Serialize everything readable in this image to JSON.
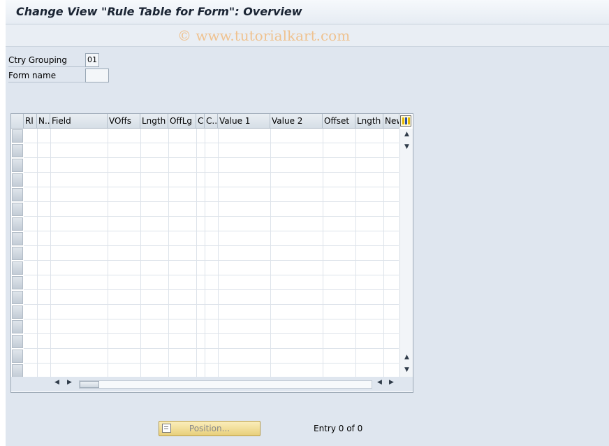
{
  "title": "Change View \"Rule Table for Form\": Overview",
  "watermark": "© www.tutorialkart.com",
  "fields": {
    "ctry_grouping_label": "Ctry Grouping",
    "ctry_grouping_value": "01",
    "form_name_label": "Form name",
    "form_name_value": ""
  },
  "table": {
    "columns": [
      "Rl",
      "N..",
      "Field",
      "VOffs",
      "Lngth",
      "OffLg",
      "C",
      "C..",
      "Value 1",
      "Value 2",
      "Offset",
      "Lngth",
      "New"
    ],
    "visible_rows": 17
  },
  "footer": {
    "position_button": "Position...",
    "entry_text": "Entry 0 of 0"
  },
  "icons": {
    "table_settings": "table-settings-icon",
    "position": "position-icon"
  },
  "colors": {
    "background": "#dfe6ef",
    "button": "#f3dc95",
    "watermark": "#efc28f"
  }
}
